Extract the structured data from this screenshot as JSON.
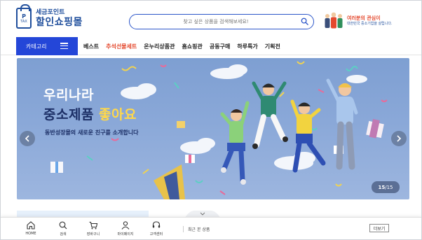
{
  "header": {
    "logo_small": "세금포인트",
    "logo_big": "할인쇼핑몰",
    "logo_bag_letter": "P",
    "logo_bag_tax": "TAX",
    "search_placeholder": "찾고 싶은 상품을 검색해보세요!",
    "promo_line1": "여러분의 관심이",
    "promo_line2": "대한민국 중소기업을 살립니다."
  },
  "nav": {
    "category_label": "카테고리",
    "items": [
      {
        "label": "베스트",
        "highlight": false
      },
      {
        "label": "추석선물세트",
        "highlight": true
      },
      {
        "label": "온누리상품관",
        "highlight": false
      },
      {
        "label": "홈쇼핑관",
        "highlight": false
      },
      {
        "label": "공동구매",
        "highlight": false
      },
      {
        "label": "하루특가",
        "highlight": false
      },
      {
        "label": "기획전",
        "highlight": false
      }
    ]
  },
  "banner": {
    "title_line1": "우리나라",
    "title_line2_a": "중소제품",
    "title_line2_b": "좋아요",
    "subtitle": "동반성장몰의 새로운 친구를 소개합니다",
    "current_slide": "15",
    "total_slides": "15",
    "counter_sep": " / "
  },
  "bottom_bar": {
    "tabs": [
      {
        "label": "HOME",
        "icon": "home-icon"
      },
      {
        "label": "검색",
        "icon": "search-icon"
      },
      {
        "label": "장바구니",
        "icon": "cart-icon"
      },
      {
        "label": "마이페이지",
        "icon": "user-icon"
      },
      {
        "label": "고객센터",
        "icon": "headset-icon"
      }
    ],
    "recent_label": "최근 본 상품",
    "more_label": "더보기"
  },
  "colors": {
    "brand": "#1f4e9c",
    "accent": "#2446d8",
    "highlight": "#e4492e",
    "banner_bg": "#8aa8d8"
  }
}
